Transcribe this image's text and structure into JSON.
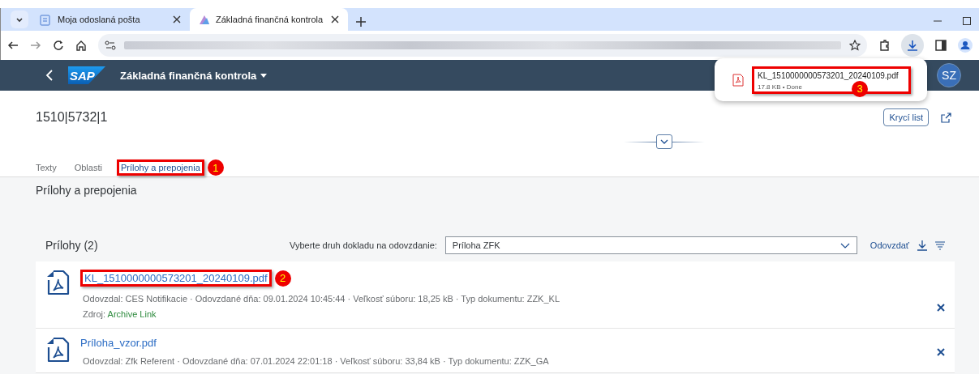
{
  "browser": {
    "tabs": [
      {
        "title": "Moja odoslaná pošta",
        "selected": false
      },
      {
        "title": "Základná finančná kontrola",
        "selected": true
      }
    ]
  },
  "download_bubble": {
    "filename": "KL_1510000000573201_20240109.pdf",
    "status": "17.8 KB • Done",
    "callout": "3"
  },
  "shell": {
    "logo": "SAP",
    "title": "Základná finančná kontrola",
    "avatar": "SZ"
  },
  "header": {
    "title": "1510|5732|1",
    "cover_button": "Krycí list"
  },
  "tabs": [
    {
      "label": "Texty",
      "selected": false
    },
    {
      "label": "Oblasti",
      "selected": false
    },
    {
      "label": "Prílohy a prepojenia",
      "selected": true,
      "callout": "1"
    }
  ],
  "section": {
    "title": "Prílohy a prepojenia"
  },
  "attachments": {
    "title": "Prílohy (2)",
    "doc_type_label": "Vyberte druh dokladu na odovzdanie:",
    "doc_type_value": "Príloha ZFK",
    "upload_button": "Odovzdať",
    "items": [
      {
        "name": "KL_1510000000573201_20240109.pdf",
        "meta": "Odovzdal: CES Notifikacie · Odovzdané dňa: 09.01.2024 10:45:44 · Veľkosť súboru: 18,25 kB · Typ dokumentu: ZZK_KL",
        "source_label": "Zdroj:",
        "source_value": "Archive Link",
        "callout": "2"
      },
      {
        "name": "Príloha_vzor.pdf",
        "meta": "Odovzdal: Zfk Referent · Odovzdané dňa: 07.01.2024 22:01:18 · Veľkosť súboru: 33,84 kB · Typ dokumentu: ZZK_GA"
      }
    ]
  }
}
